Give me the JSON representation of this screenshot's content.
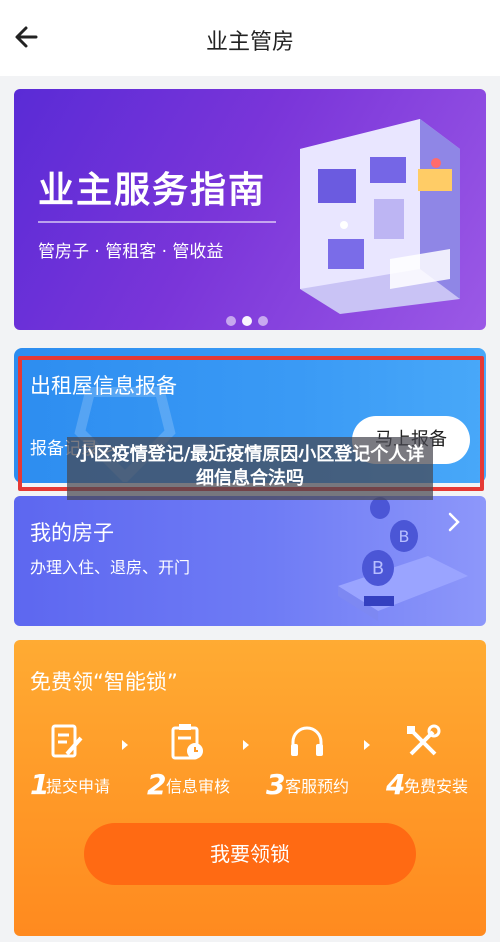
{
  "header": {
    "title": "业主管房",
    "back_icon": "arrow-left-icon"
  },
  "banner": {
    "title": "业主服务指南",
    "subtitle": "管房子 · 管租客 · 管收益",
    "slides_total": 3,
    "active_slide": 2
  },
  "rent_card": {
    "title": "出租屋信息报备",
    "record_link": "报备记录 >",
    "action_button": "马上报备",
    "highlight_color": "#e53935"
  },
  "overlay_caption": "小区疫情登记/最近疫情原因小区登记个人详细信息合法吗",
  "house_card": {
    "title": "我的房子",
    "subtitle": "办理入住、退房、开门"
  },
  "lock_card": {
    "title": "免费领“智能锁”",
    "steps": [
      {
        "num": "1",
        "label": "提交申请",
        "icon": "edit-form-icon"
      },
      {
        "num": "2",
        "label": "信息审核",
        "icon": "clipboard-clock-icon"
      },
      {
        "num": "3",
        "label": "客服预约",
        "icon": "headset-icon"
      },
      {
        "num": "4",
        "label": "免费安装",
        "icon": "tools-icon"
      }
    ],
    "button": "我要领锁"
  },
  "colors": {
    "banner_purple": "#6a30d8",
    "rent_blue": "#3a9af5",
    "house_indigo": "#6f7cf5",
    "lock_orange": "#ff9a28",
    "lock_button": "#ff6a13"
  }
}
